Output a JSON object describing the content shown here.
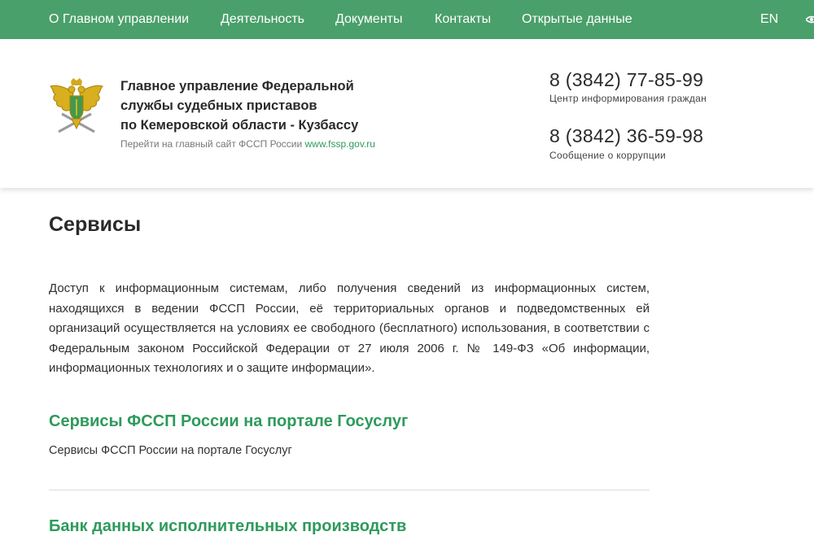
{
  "nav": {
    "items": [
      "О Главном управлении",
      "Деятельность",
      "Документы",
      "Контакты",
      "Открытые данные"
    ],
    "lang": "EN"
  },
  "header": {
    "org_name_lines": [
      "Главное управление Федеральной",
      "службы судебных приставов",
      "по Кемеровской области - Кузбассу"
    ],
    "link_prefix": "Перейти на главный сайт ФССП России ",
    "link_text": "www.fssp.gov.ru",
    "phones": [
      {
        "number": "8 (3842) 77-85-99",
        "caption": "Центр информирования граждан"
      },
      {
        "number": "8 (3842) 36-59-98",
        "caption": "Сообщение о коррупции"
      }
    ]
  },
  "main": {
    "title": "Сервисы",
    "intro": "Доступ к информационным системам, либо получения сведений из информационных систем, находящихся в ведении ФССП России, её территориальных органов и подведомственных ей организаций осуществляется на условиях ее свободного (бесплатного) использования, в соответствии с Федеральным законом Российской Федерации от 27 июля 2006 г. № 149-ФЗ «Об информации, информационных технологиях и о защите информации».",
    "services": [
      {
        "title": "Сервисы ФССП России на портале Госуслуг",
        "desc": "Сервисы ФССП России на портале Госуслуг"
      },
      {
        "title": "Банк данных исполнительных производств",
        "desc": ""
      }
    ]
  },
  "colors": {
    "brand_green": "#4aa06a",
    "link_green": "#2e9a5c"
  },
  "icons": {
    "emblem": "fssp-eagle-emblem",
    "accessibility": "eye-icon"
  }
}
